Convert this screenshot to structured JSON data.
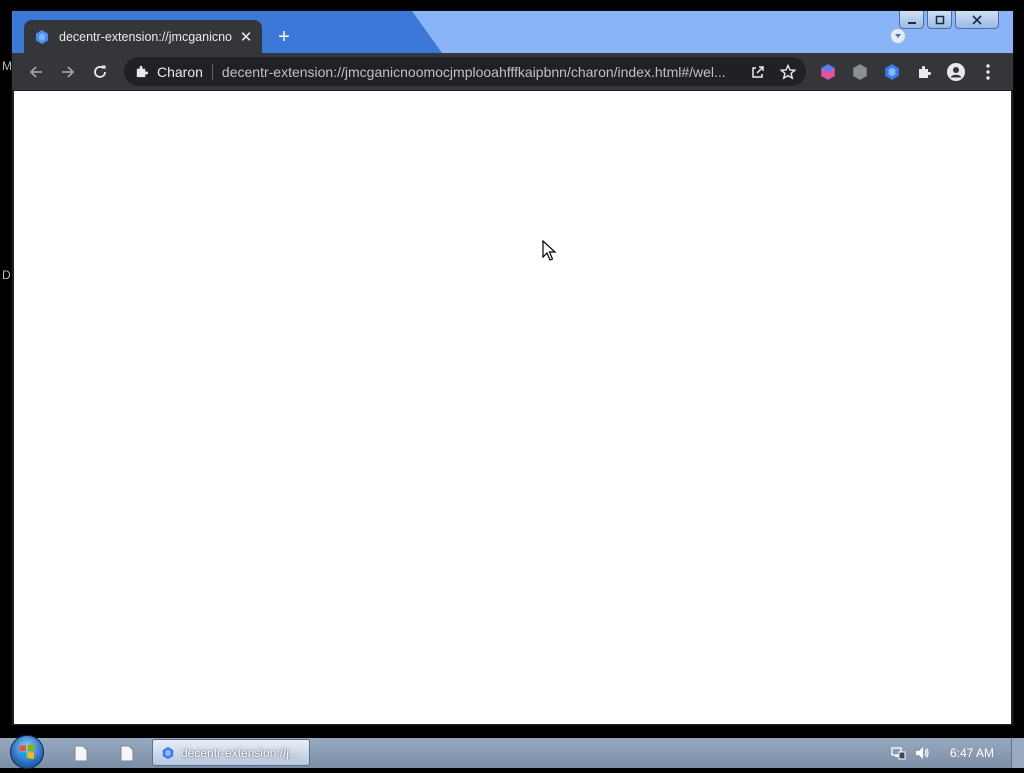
{
  "desktop": {
    "left_glyph_top": "M",
    "left_glyph_mid": "D"
  },
  "tab": {
    "title": "decentr-extension://jmcganicnoc"
  },
  "toolbar": {
    "chip": "Charon",
    "url": "decentr-extension://jmcganicnoomocjmplooahfffkaipbnn/charon/index.html#/wel..."
  },
  "taskbar": {
    "task_label": "decentr-extension://j...",
    "clock": "6:47 AM"
  },
  "colors": {
    "frame": "#3c78d8",
    "toolbar": "#35363a",
    "omnibox": "#202124",
    "page": "#ffffff"
  }
}
